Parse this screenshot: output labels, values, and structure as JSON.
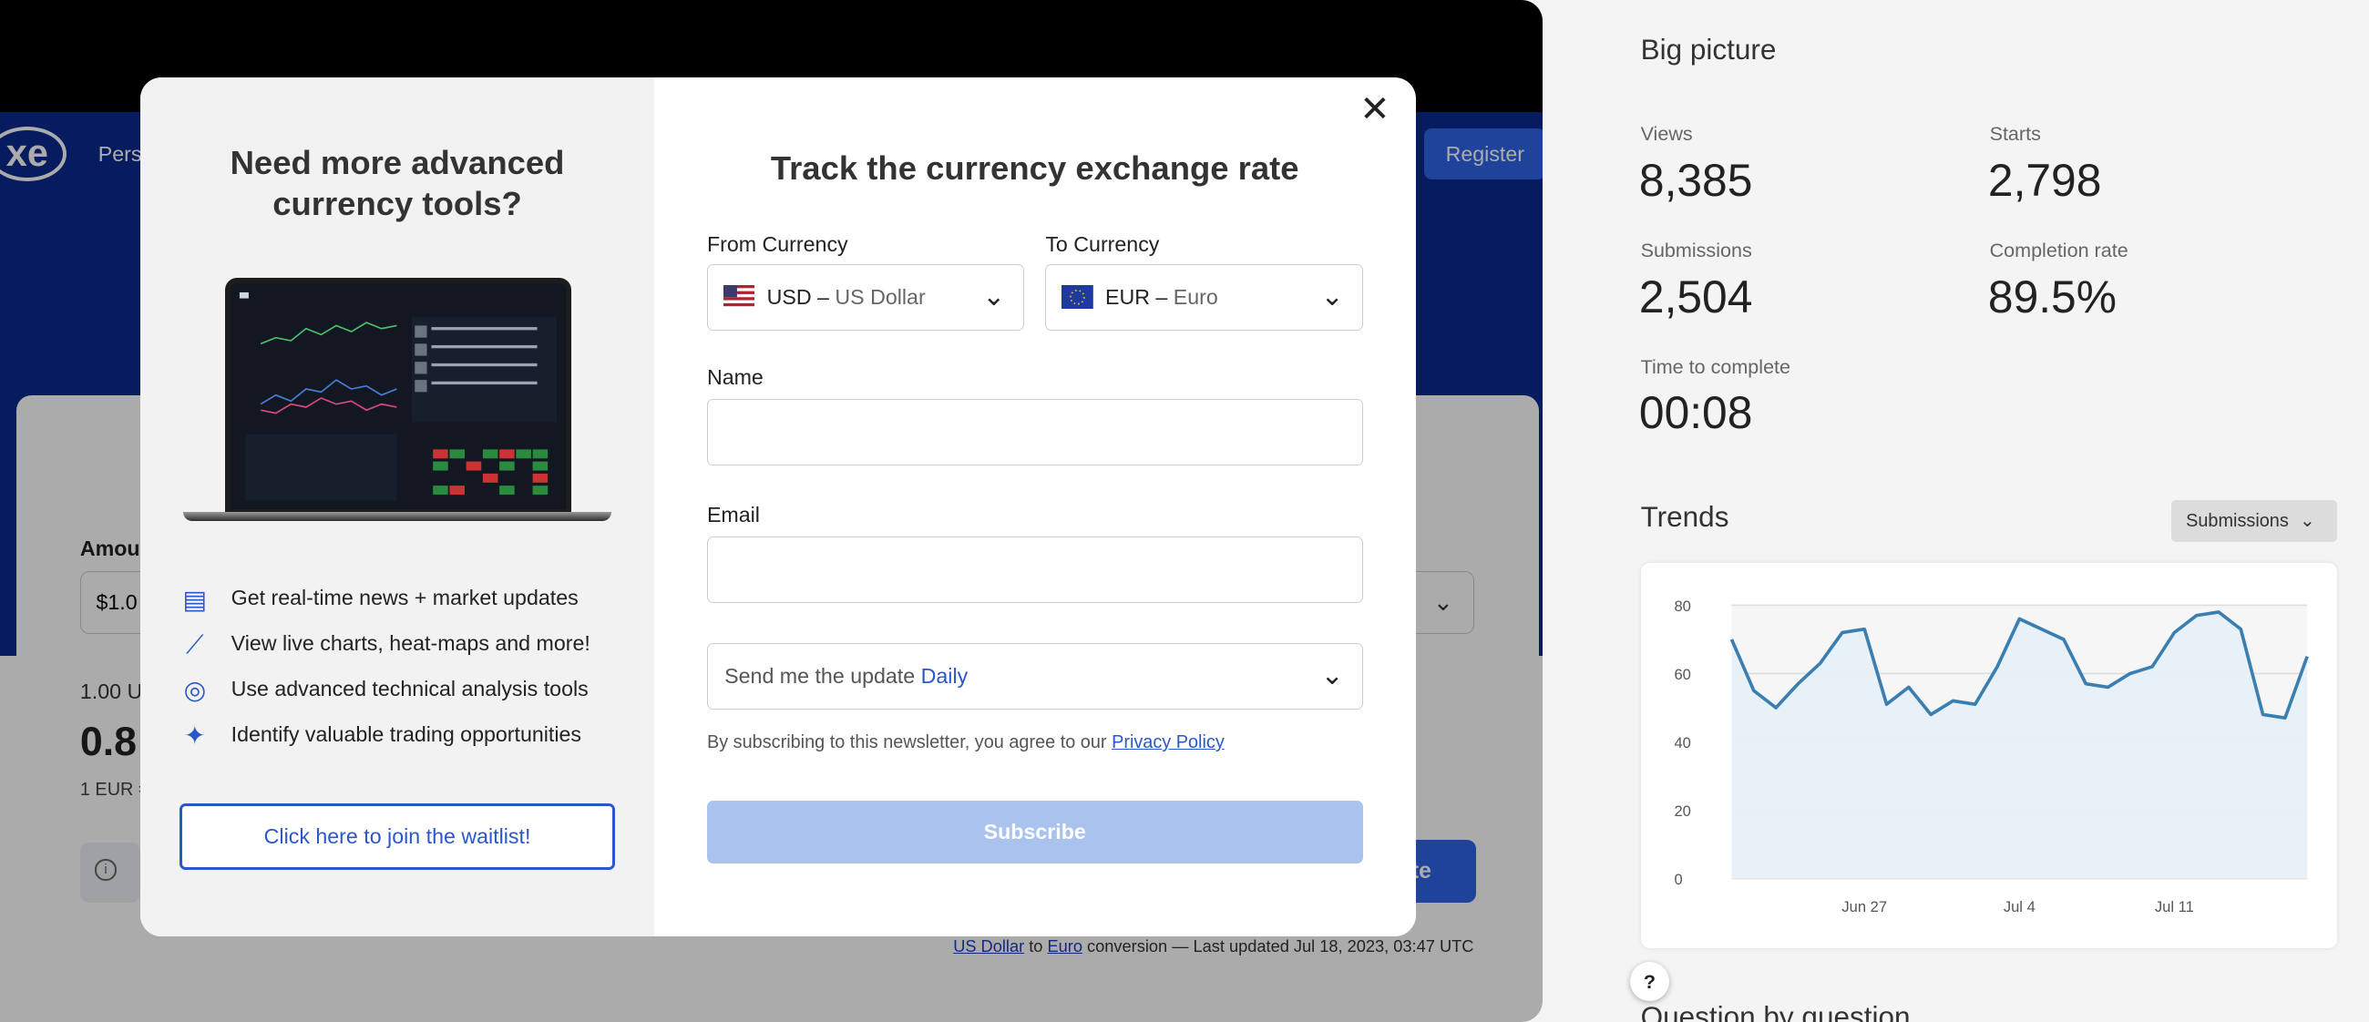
{
  "background_page": {
    "logo": "xe",
    "nav_partial": "Pers",
    "register_label": "Register",
    "amount_label_partial": "Amou",
    "amount_value_partial": "$1.0",
    "rate_line1_partial": "1.00 U",
    "rate_big_partial": "0.8",
    "rate_line3_partial": "1 EUR =",
    "quote_button_partial": "ote",
    "footer_from_link": "US Dollar",
    "footer_to_word": "to",
    "footer_to_link": "Euro",
    "footer_rest": "conversion — Last updated Jul 18, 2023, 03:47 UTC"
  },
  "modal": {
    "left_title": "Need more advanced currency tools?",
    "features": [
      {
        "icon": "newspaper-icon",
        "text": "Get real-time news + market updates"
      },
      {
        "icon": "line-chart-icon",
        "text": "View live charts, heat-maps and more!"
      },
      {
        "icon": "target-icon",
        "text": "Use advanced technical analysis tools"
      },
      {
        "icon": "sparkle-icon",
        "text": "Identify valuable trading opportunities"
      }
    ],
    "waitlist_label": "Click here to join the waitlist!",
    "title": "Track the currency exchange rate",
    "from_label": "From Currency",
    "from_code": "USD",
    "from_name": "US Dollar",
    "to_label": "To Currency",
    "to_code": "EUR",
    "to_name": "Euro",
    "name_label": "Name",
    "email_label": "Email",
    "frequency_prefix": "Send me the update",
    "frequency_value": "Daily",
    "terms_text": "By subscribing to this newsletter, you agree to our",
    "privacy_link": "Privacy Policy",
    "subscribe_label": "Subscribe"
  },
  "panel": {
    "title": "Big picture",
    "stats": [
      {
        "label": "Views",
        "value": "8,385"
      },
      {
        "label": "Starts",
        "value": "2,798"
      },
      {
        "label": "Submissions",
        "value": "2,504"
      },
      {
        "label": "Completion rate",
        "value": "89.5%"
      },
      {
        "label": "Time to complete",
        "value": "00:08"
      }
    ],
    "trends_title": "Trends",
    "trends_dropdown": "Submissions",
    "help_label": "?",
    "next_section_partial": "Question by question"
  },
  "chart_data": {
    "type": "area",
    "y_ticks": [
      "0",
      "20",
      "40",
      "60",
      "80"
    ],
    "ylim": [
      0,
      80
    ],
    "x_tick_labels": [
      "Jun 27",
      "Jul 4",
      "Jul 11"
    ],
    "x_tick_index": [
      6,
      13,
      20
    ],
    "values": [
      70,
      55,
      50,
      57,
      63,
      72,
      73,
      51,
      56,
      48,
      52,
      51,
      62,
      76,
      73,
      70,
      57,
      56,
      60,
      62,
      72,
      77,
      78,
      73,
      48,
      47,
      65
    ],
    "color": "#3b7fb0",
    "fill": "#e7f1f8"
  }
}
